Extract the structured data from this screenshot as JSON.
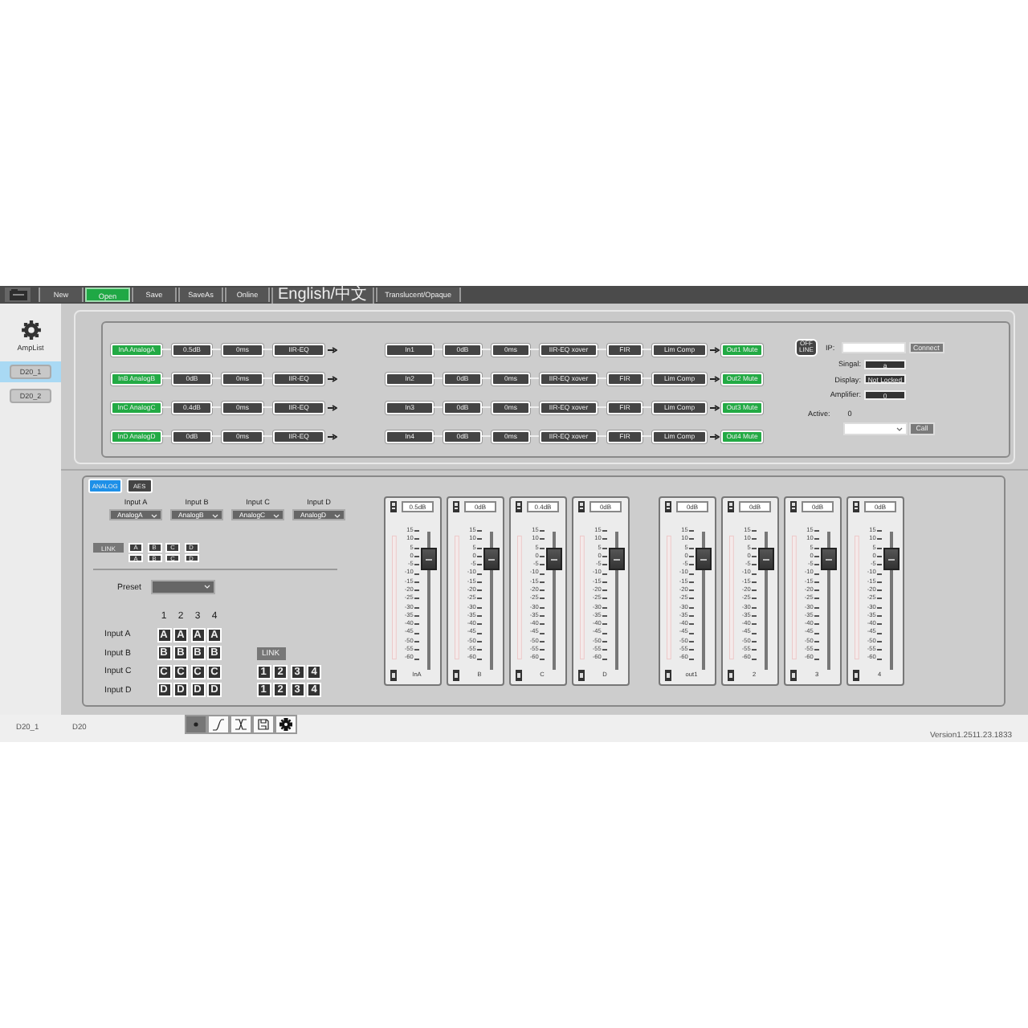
{
  "menu": {
    "items": [
      {
        "label": "New",
        "selected": false
      },
      {
        "label": "Open",
        "selected": true
      },
      {
        "label": "Save",
        "selected": false
      },
      {
        "label": "SaveAs",
        "selected": false
      },
      {
        "label": "Online",
        "selected": false
      },
      {
        "label": "English/中文",
        "selected": false
      },
      {
        "label": "Translucent/Opaque",
        "selected": false
      }
    ]
  },
  "sidebar": {
    "title": "AmpList",
    "items": [
      {
        "label": "D20_1",
        "selected": true
      },
      {
        "label": "D20_2",
        "selected": false
      }
    ]
  },
  "routing": {
    "rows": [
      {
        "input": "InA AnalogA",
        "gain": "0.5dB",
        "delay": "0ms",
        "eq": "IIR-EQ",
        "channel": "In1",
        "out_gain": "0dB",
        "out_delay": "0ms",
        "xover": "IIR-EQ xover",
        "fir": "FIR",
        "limiter": "Lim Comp",
        "output": "Out1 Mute"
      },
      {
        "input": "InB AnalogB",
        "gain": "0dB",
        "delay": "0ms",
        "eq": "IIR-EQ",
        "channel": "In2",
        "out_gain": "0dB",
        "out_delay": "0ms",
        "xover": "IIR-EQ xover",
        "fir": "FIR",
        "limiter": "Lim Comp",
        "output": "Out2 Mute"
      },
      {
        "input": "InC AnalogC",
        "gain": "0.4dB",
        "delay": "0ms",
        "eq": "IIR-EQ",
        "channel": "In3",
        "out_gain": "0dB",
        "out_delay": "0ms",
        "xover": "IIR-EQ xover",
        "fir": "FIR",
        "limiter": "Lim Comp",
        "output": "Out3 Mute"
      },
      {
        "input": "InD AnalogD",
        "gain": "0dB",
        "delay": "0ms",
        "eq": "IIR-EQ",
        "channel": "In4",
        "out_gain": "0dB",
        "out_delay": "0ms",
        "xover": "IIR-EQ xover",
        "fir": "FIR",
        "limiter": "Lim Comp",
        "output": "Out4 Mute"
      }
    ]
  },
  "connection": {
    "offline_button": "OFF LINE",
    "ip_label": "IP:",
    "connect_button": "Connect",
    "status": [
      {
        "label": "Singal:",
        "value": "a"
      },
      {
        "label": "Display:",
        "value": "Not Locked"
      },
      {
        "label": "Amplifier:",
        "value": "0"
      }
    ],
    "active_label": "Active:",
    "active_value": "0",
    "call_button": "Call"
  },
  "input_panel": {
    "tabs": [
      {
        "label": "ANALOG",
        "selected": true
      },
      {
        "label": "AES",
        "selected": false
      }
    ],
    "inputs": [
      {
        "label": "Input A",
        "value": "AnalogA"
      },
      {
        "label": "Input B",
        "value": "AnalogB"
      },
      {
        "label": "Input C",
        "value": "AnalogC"
      },
      {
        "label": "Input D",
        "value": "AnalogD"
      }
    ],
    "link_button": "LINK",
    "link_rows": [
      [
        "A",
        "B",
        "C",
        "D"
      ],
      [
        "A",
        "B",
        "C",
        "D"
      ]
    ],
    "preset_label": "Preset",
    "matrix": {
      "columns": [
        "1",
        "2",
        "3",
        "4"
      ],
      "rows": [
        {
          "label": "Input A",
          "cells": [
            "A",
            "A",
            "A",
            "A"
          ]
        },
        {
          "label": "Input B",
          "cells": [
            "B",
            "B",
            "B",
            "B"
          ]
        },
        {
          "label": "Input C",
          "cells": [
            "C",
            "C",
            "C",
            "C"
          ]
        },
        {
          "label": "Input D",
          "cells": [
            "D",
            "D",
            "D",
            "D"
          ]
        }
      ]
    },
    "output_link": {
      "label": "LINK",
      "rows": [
        [
          "1",
          "2",
          "3",
          "4"
        ],
        [
          "1",
          "2",
          "3",
          "4"
        ]
      ]
    }
  },
  "input_faders": [
    {
      "gain": "0.5dB",
      "label": "InA",
      "level": 0.8,
      "scale": [
        "15",
        "10",
        "5",
        "0",
        "-5",
        "-10",
        "-15",
        "-20",
        "-25",
        "-30",
        "-35",
        "-40",
        "-45",
        "-50",
        "-55",
        "-60"
      ]
    },
    {
      "gain": "0dB",
      "label": "B",
      "level": 0.8,
      "scale": [
        "15",
        "10",
        "5",
        "0",
        "-5",
        "-10",
        "-15",
        "-20",
        "-25",
        "-30",
        "-35",
        "-40",
        "-45",
        "-50",
        "-55",
        "-60"
      ]
    },
    {
      "gain": "0.4dB",
      "label": "C",
      "level": 0.8,
      "scale": [
        "15",
        "10",
        "5",
        "0",
        "-5",
        "-10",
        "-15",
        "-20",
        "-25",
        "-30",
        "-35",
        "-40",
        "-45",
        "-50",
        "-55",
        "-60"
      ]
    },
    {
      "gain": "0dB",
      "label": "D",
      "level": 0.8,
      "scale": [
        "15",
        "10",
        "5",
        "0",
        "-5",
        "-10",
        "-15",
        "-20",
        "-25",
        "-30",
        "-35",
        "-40",
        "-45",
        "-50",
        "-55",
        "-60"
      ]
    }
  ],
  "output_faders": [
    {
      "gain": "0dB",
      "label": "out1",
      "level": 0.8,
      "scale": [
        "15",
        "10",
        "5",
        "0",
        "-5",
        "-10",
        "-15",
        "-20",
        "-25",
        "-30",
        "-35",
        "-40",
        "-45",
        "-50",
        "-55",
        "-60"
      ]
    },
    {
      "gain": "0dB",
      "label": "2",
      "level": 0.8,
      "scale": [
        "15",
        "10",
        "5",
        "0",
        "-5",
        "-10",
        "-15",
        "-20",
        "-25",
        "-30",
        "-35",
        "-40",
        "-45",
        "-50",
        "-55",
        "-60"
      ]
    },
    {
      "gain": "0dB",
      "label": "3",
      "level": 0.8,
      "scale": [
        "15",
        "10",
        "5",
        "0",
        "-5",
        "-10",
        "-15",
        "-20",
        "-25",
        "-30",
        "-35",
        "-40",
        "-45",
        "-50",
        "-55",
        "-60"
      ]
    },
    {
      "gain": "0dB",
      "label": "4",
      "level": 0.8,
      "scale": [
        "15",
        "10",
        "5",
        "0",
        "-5",
        "-10",
        "-15",
        "-20",
        "-25",
        "-30",
        "-35",
        "-40",
        "-45",
        "-50",
        "-55",
        "-60"
      ]
    }
  ],
  "footer": {
    "device": "D20_1",
    "model": "D20",
    "tools": [
      {
        "kind": "circle",
        "selected": true
      },
      {
        "kind": "curve",
        "selected": false
      },
      {
        "kind": "crossover",
        "selected": false
      },
      {
        "kind": "save",
        "selected": false
      },
      {
        "kind": "settings",
        "selected": false
      }
    ],
    "version": "Version1.2511.23.1833"
  }
}
